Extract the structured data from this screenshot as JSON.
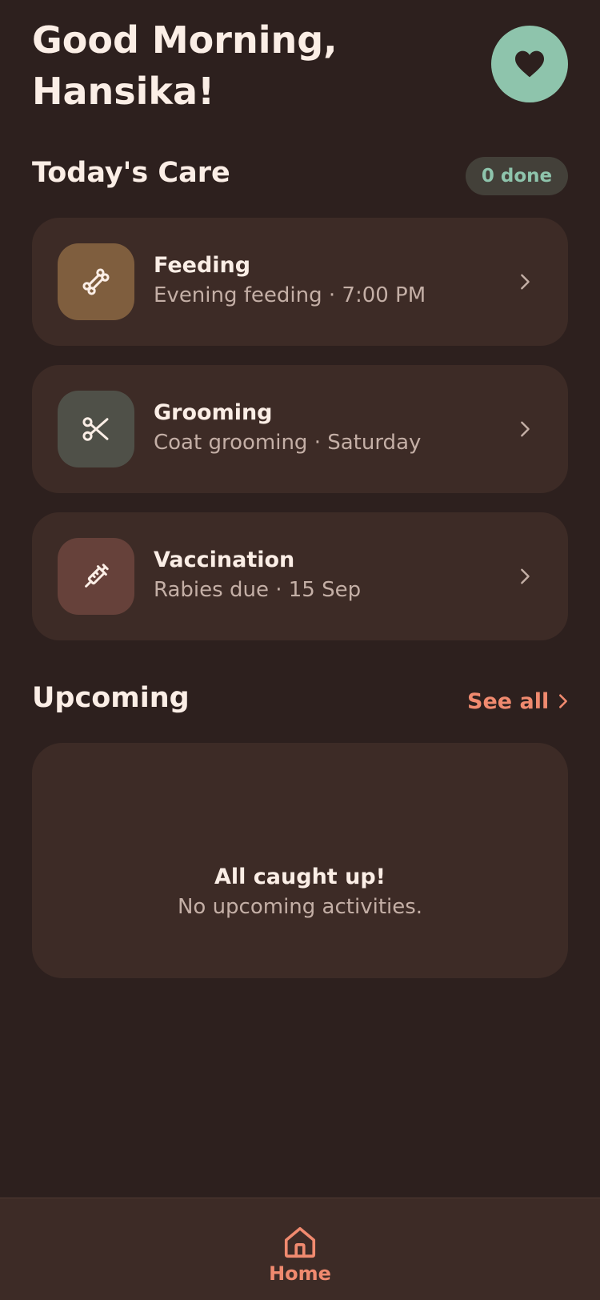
{
  "header": {
    "greeting": "Good Morning, Hansika!",
    "favorite_icon": "heart-icon"
  },
  "today": {
    "title": "Today's Care",
    "badge": "0 done",
    "items": [
      {
        "title": "Feeding",
        "subtitle": "Evening feeding · 7:00 PM",
        "icon": "bone-icon",
        "icon_bg": "#7f5e3e"
      },
      {
        "title": "Grooming",
        "subtitle": "Coat grooming · Saturday",
        "icon": "scissors-icon",
        "icon_bg": "#4f5048"
      },
      {
        "title": "Vaccination",
        "subtitle": "Rabies due · 15 Sep",
        "icon": "syringe-icon",
        "icon_bg": "#66413a"
      }
    ]
  },
  "upcoming": {
    "title": "Upcoming",
    "see_all": "See all",
    "empty_title": "All caught up!",
    "empty_subtitle": "No upcoming activities."
  },
  "nav": {
    "home_label": "Home"
  },
  "colors": {
    "background": "#2d201e",
    "card": "#3d2b26",
    "accent": "#f08a6f",
    "mint": "#8ec4ac",
    "text": "#fbeee6",
    "muted": "#c4afa6"
  }
}
